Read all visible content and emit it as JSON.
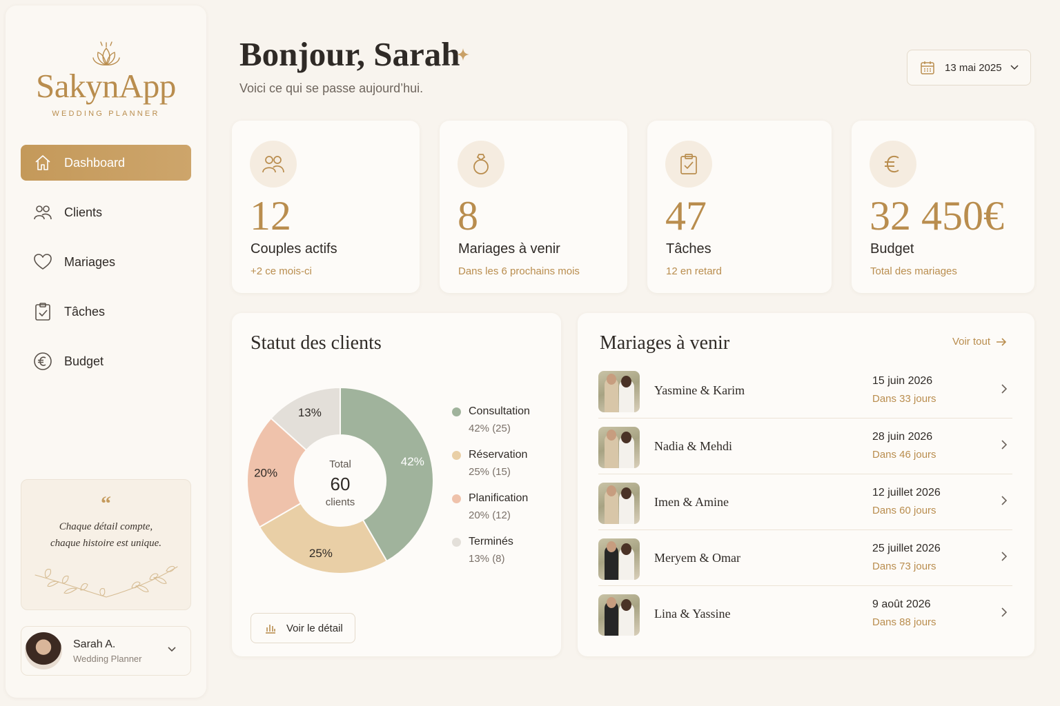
{
  "app": {
    "name": "SakynApp",
    "tagline": "WEDDING PLANNER",
    "logo_icon": "lotus-icon",
    "accent": "#b98d4e"
  },
  "sidebar": {
    "items": [
      {
        "label": "Dashboard",
        "icon": "home-icon",
        "active": true
      },
      {
        "label": "Clients",
        "icon": "users-icon",
        "active": false
      },
      {
        "label": "Mariages",
        "icon": "heart-icon",
        "active": false
      },
      {
        "label": "Tâches",
        "icon": "clipboard-check-icon",
        "active": false
      },
      {
        "label": "Budget",
        "icon": "euro-icon",
        "active": false
      }
    ],
    "quote": {
      "mark": "“",
      "line1": "Chaque détail compte,",
      "line2": "chaque histoire est unique."
    },
    "user": {
      "name": "Sarah A.",
      "role": "Wedding Planner"
    }
  },
  "header": {
    "greeting": "Bonjour, Sarah",
    "subtitle": "Voici ce qui se passe aujourd’hui.",
    "date": "13 mai 2025"
  },
  "stats": [
    {
      "icon": "users-icon",
      "value": "12",
      "label": "Couples actifs",
      "note": "+2 ce mois-ci"
    },
    {
      "icon": "ring-icon",
      "value": "8",
      "label": "Mariages à venir",
      "note": "Dans les 6 prochains mois"
    },
    {
      "icon": "clipboard-check-icon",
      "value": "47",
      "label": "Tâches",
      "note": "12 en retard"
    },
    {
      "icon": "euro-icon",
      "value": "32 450€",
      "label": "Budget",
      "note": "Total des mariages"
    }
  ],
  "client_status": {
    "title": "Statut des clients",
    "center_label": "Total",
    "center_value": "60",
    "center_unit": "clients",
    "detail_button": "Voir le détail",
    "legend": [
      {
        "name": "Consultation",
        "value": "42% (25)",
        "color": "#a0b39c"
      },
      {
        "name": "Réservation",
        "value": "25% (15)",
        "color": "#e9cfa6"
      },
      {
        "name": "Planification",
        "value": "20% (12)",
        "color": "#efc2ab"
      },
      {
        "name": "Terminés",
        "value": "13% (8)",
        "color": "#e3dfd9"
      }
    ]
  },
  "chart_data": {
    "type": "pie",
    "title": "Statut des clients",
    "categories": [
      "Consultation",
      "Réservation",
      "Planification",
      "Terminés"
    ],
    "values": [
      25,
      15,
      12,
      8
    ],
    "percent_labels": [
      "42%",
      "25%",
      "20%",
      "13%"
    ],
    "colors": [
      "#a0b39c",
      "#e9cfa6",
      "#efc2ab",
      "#e3dfd9"
    ],
    "total": 60
  },
  "upcoming": {
    "title": "Mariages à venir",
    "see_all": "Voir tout",
    "items": [
      {
        "couple": "Yasmine & Karim",
        "date": "15 juin 2026",
        "days": "Dans 33 jours",
        "suit": "#d8c6a8"
      },
      {
        "couple": "Nadia & Mehdi",
        "date": "28 juin 2026",
        "days": "Dans 46 jours",
        "suit": "#d8c6a8"
      },
      {
        "couple": "Imen & Amine",
        "date": "12 juillet 2026",
        "days": "Dans 60 jours",
        "suit": "#d8c6a8"
      },
      {
        "couple": "Meryem & Omar",
        "date": "25 juillet 2026",
        "days": "Dans 73 jours",
        "suit": "#262626"
      },
      {
        "couple": "Lina & Yassine",
        "date": "9 août 2026",
        "days": "Dans 88 jours",
        "suit": "#262626"
      }
    ]
  }
}
